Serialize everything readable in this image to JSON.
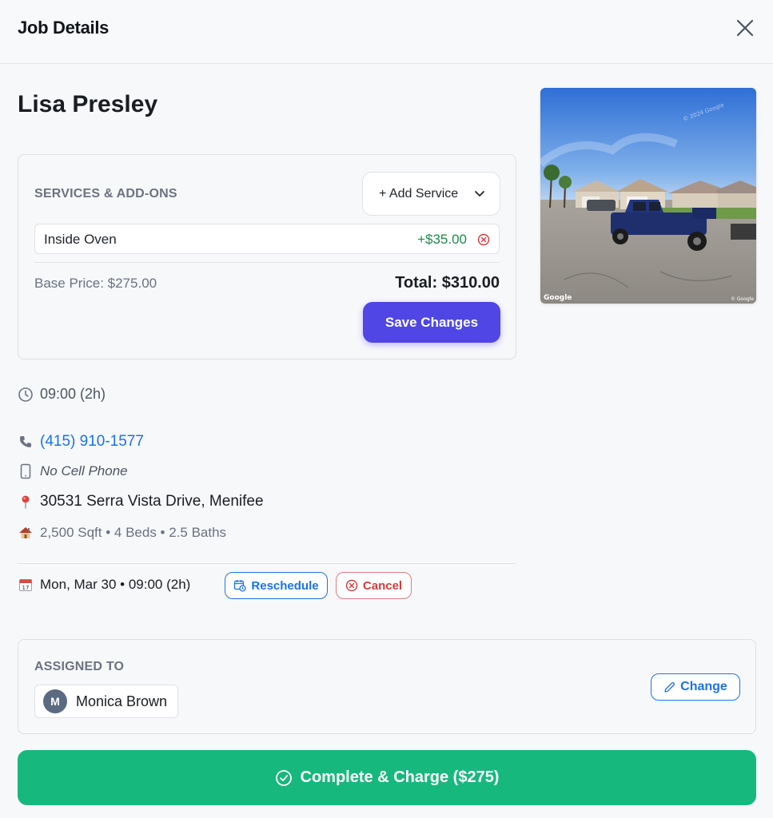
{
  "header": {
    "title": "Job Details"
  },
  "customer": {
    "name": "Lisa Presley"
  },
  "street_view": {
    "watermark_left": "Google",
    "watermark_right": "© Google",
    "watermark_top": "© 2024 Google"
  },
  "services": {
    "heading": "SERVICES & ADD-ONS",
    "add_service_label": "+ Add Service",
    "items": [
      {
        "name": "Inside Oven",
        "price": "+$35.00"
      }
    ],
    "base_price": "Base Price: $275.00",
    "total": "Total: $310.00",
    "save_label": "Save Changes"
  },
  "schedule": {
    "time": "09:00 (2h)"
  },
  "contact": {
    "phone": "(415) 910-1577",
    "cell": "No Cell Phone",
    "address": "30531 Serra Vista Drive, Menifee",
    "home_stats": "2,500 Sqft • 4 Beds • 2.5 Baths"
  },
  "appointment": {
    "date": "Mon, Mar 30 • 09:00 (2h)",
    "reschedule_label": "Reschedule",
    "cancel_label": "Cancel"
  },
  "assigned": {
    "heading": "ASSIGNED TO",
    "avatar_initial": "M",
    "name": "Monica Brown",
    "change_label": "Change"
  },
  "complete": {
    "label": "Complete & Charge ($275)"
  },
  "colors": {
    "accent": "#4f46e5",
    "link": "#1a73e8",
    "success": "#16b87e",
    "price_green": "#1e8a4c",
    "danger": "#d63b3b"
  }
}
